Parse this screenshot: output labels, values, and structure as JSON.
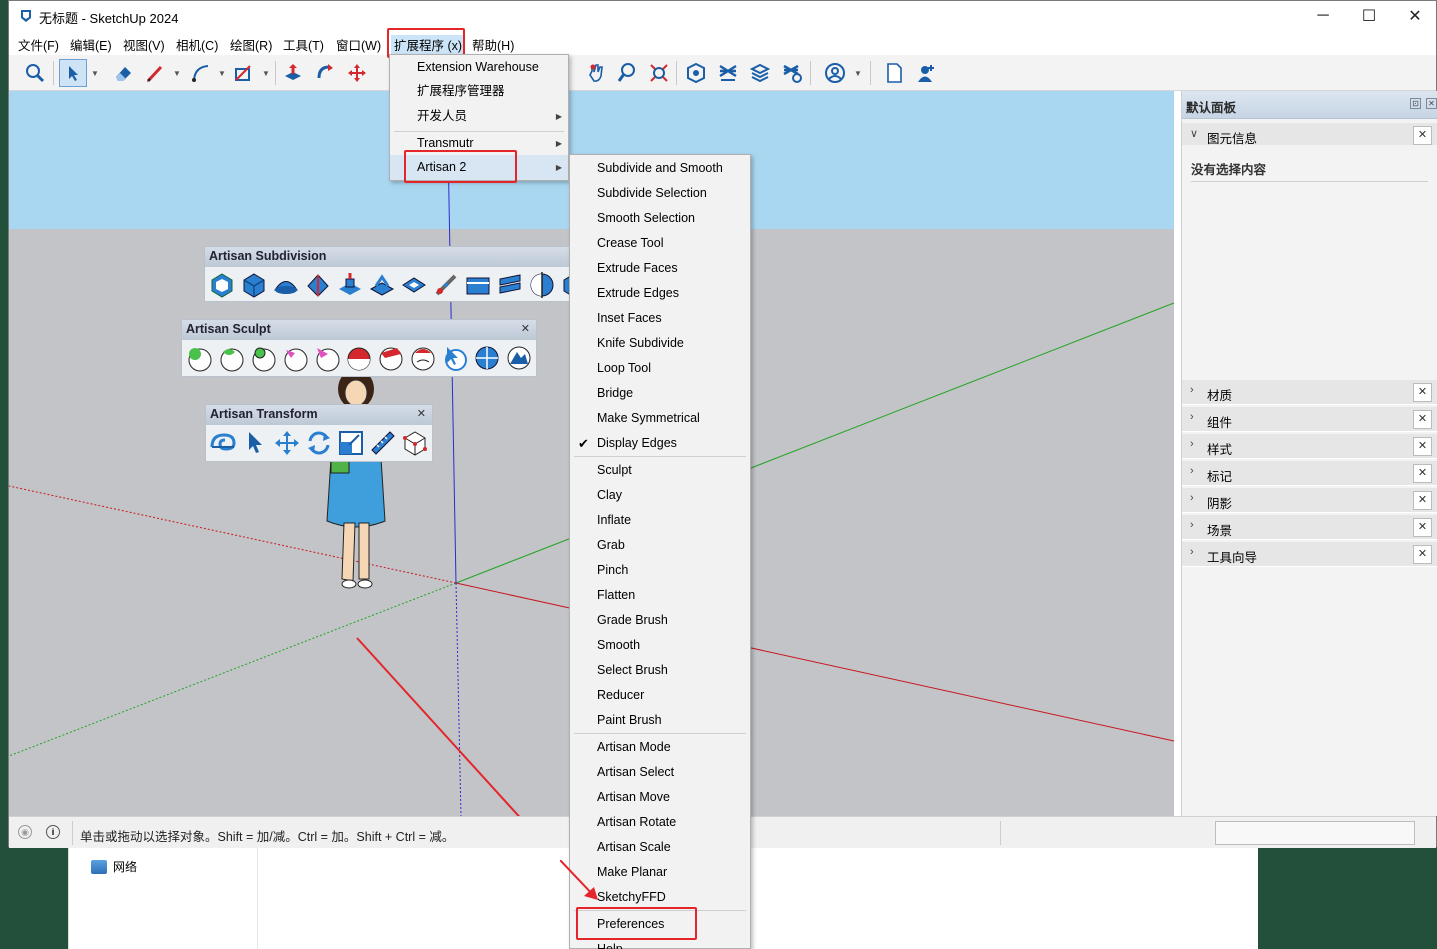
{
  "window": {
    "title": "无标题 - SketchUp 2024"
  },
  "menubar": [
    "文件(F)",
    "编辑(E)",
    "视图(V)",
    "相机(C)",
    "绘图(R)",
    "工具(T)",
    "窗口(W)",
    "扩展程序 (x)",
    "帮助(H)"
  ],
  "extensions_menu": {
    "items": [
      "Extension Warehouse",
      "扩展程序管理器",
      "开发人员",
      "Transmutr",
      "Artisan 2"
    ]
  },
  "artisan_submenu": {
    "group1": [
      "Subdivide and Smooth",
      "Subdivide Selection",
      "Smooth Selection",
      "Crease Tool",
      "Extrude Faces",
      "Extrude Edges",
      "Inset Faces",
      "Knife Subdivide",
      "Loop Tool",
      "Bridge",
      "Make Symmetrical",
      "Display Edges"
    ],
    "group2": [
      "Sculpt",
      "Clay",
      "Inflate",
      "Grab",
      "Pinch",
      "Flatten",
      "Grade Brush",
      "Smooth",
      "Select Brush",
      "Reducer",
      "Paint Brush"
    ],
    "group3": [
      "Artisan Mode",
      "Artisan Select",
      "Artisan Move",
      "Artisan Rotate",
      "Artisan Scale",
      "Make Planar",
      "SketchyFFD"
    ],
    "group4": [
      "Preferences",
      "Help"
    ],
    "checked": "Display Edges"
  },
  "floating_toolbars": {
    "subdivision": "Artisan Subdivision",
    "sculpt": "Artisan Sculpt",
    "transform": "Artisan Transform"
  },
  "tray": {
    "title": "默认面板",
    "entity_info": "图元信息",
    "no_selection": "没有选择内容",
    "panels": [
      "材质",
      "组件",
      "样式",
      "标记",
      "阴影",
      "场景",
      "工具向导"
    ]
  },
  "statusbar": {
    "message": "单击或拖动以选择对象。Shift = 加/减。Ctrl = 加。Shift + Ctrl = 减。"
  },
  "explorer": {
    "network": "网络"
  },
  "colors": {
    "sky": "#a9d7f1",
    "ground": "#c3c4c8",
    "highlight_red": "#e4262b",
    "red_axis": "#c9161e",
    "green_axis": "#1fa31f",
    "blue_axis": "#2b2bd0"
  }
}
